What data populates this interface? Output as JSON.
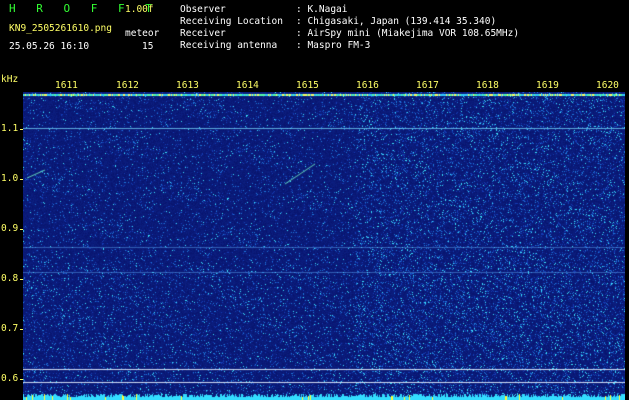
{
  "header": {
    "brand": "H R O F F T",
    "version": "1.00f",
    "filename": "KN9_2505261610.png",
    "datetime": "25.05.26 16:10",
    "meteor_label": "meteor",
    "meteor_count": "15",
    "observer_label": "Observer",
    "observer_value": ": K.Nagai",
    "location_label": "Receiving Location",
    "location_value": ": Chigasaki, Japan (139.414 35.340)",
    "receiver_label": "Receiver",
    "receiver_value": ": AirSpy mini (Miakejima VOR 108.65MHz)",
    "antenna_label": "Receiving antenna",
    "antenna_value": ": Maspro FM-3"
  },
  "axes": {
    "y_unit": "kHz",
    "y_ticks": [
      "1.1",
      "1.0",
      "0.9",
      "0.8",
      "0.7",
      "0.6"
    ],
    "x_ticks": [
      "1611",
      "1612",
      "1613",
      "1614",
      "1615",
      "1616",
      "1617",
      "1618",
      "1619",
      "1620"
    ]
  },
  "colors": {
    "background": "#000000",
    "plot_base": "#0a1a7a",
    "label_yellow": "#ffff66",
    "label_green": "#33ff33",
    "signal_cyan": "#33ddff"
  }
}
